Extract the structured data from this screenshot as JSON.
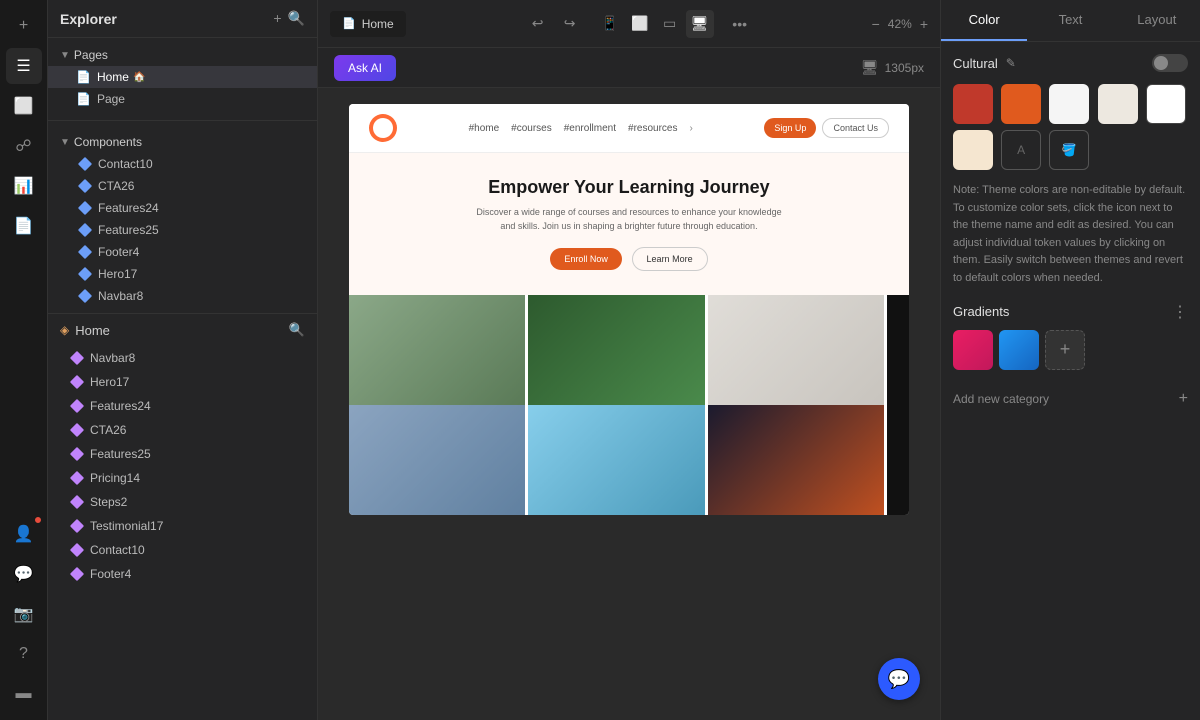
{
  "app": {
    "title": "Explorer"
  },
  "header": {
    "tab_label": "Home",
    "zoom": "42%",
    "canvas_size": "1305px"
  },
  "toolbar": {
    "ask_ai": "Ask AI",
    "undo_icon": "undo-icon",
    "redo_icon": "redo-icon",
    "device_mobile": "mobile-icon",
    "device_tablet": "tablet-icon",
    "device_desktop": "desktop-icon",
    "device_wide": "wide-icon",
    "more_icon": "more-icon",
    "zoom_out": "zoom-out-icon",
    "zoom_in": "zoom-in-icon"
  },
  "explorer": {
    "title": "Explorer",
    "pages_section": "Pages",
    "pages": [
      {
        "label": "Home",
        "active": true,
        "has_home_icon": true
      },
      {
        "label": "Page",
        "active": false,
        "has_home_icon": false
      }
    ],
    "components_section": "Components",
    "components": [
      "Contact10",
      "CTA26",
      "Features24",
      "Features25",
      "Footer4",
      "Hero17",
      "Navbar8"
    ]
  },
  "home_layer": {
    "title": "Home",
    "items": [
      "Navbar8",
      "Hero17",
      "Features24",
      "CTA26",
      "Features25",
      "Pricing14",
      "Steps2",
      "Testimonial17",
      "Contact10",
      "Footer4"
    ]
  },
  "preview": {
    "nav_links": [
      "#home",
      "#courses",
      "#enrollment",
      "#resources",
      "›"
    ],
    "signup_btn": "Sign Up",
    "contact_btn": "Contact Us",
    "hero_title": "Empower Your Learning Journey",
    "hero_desc": "Discover a wide range of courses and resources to enhance your knowledge and skills. Join us in shaping a brighter future through education.",
    "hero_btn1": "Enroll Now",
    "hero_btn2": "Learn More"
  },
  "right_panel": {
    "tabs": [
      "Color",
      "Text",
      "Layout"
    ],
    "active_tab": "Color",
    "theme_name": "Cultural",
    "note": "Note: Theme colors are non-editable by default. To customize color sets, click the icon next to the theme name and edit as desired. You can adjust individual token values by clicking on them. Easily switch between themes and revert to default colors when needed.",
    "gradients_title": "Gradients",
    "add_category_label": "Add new category",
    "swatches": [
      {
        "color": "#c0392b",
        "type": "solid"
      },
      {
        "color": "#e05a1e",
        "type": "solid"
      },
      {
        "color": "#f5f5f5",
        "type": "solid"
      },
      {
        "color": "#ede8e0",
        "type": "solid"
      },
      {
        "color": "#ffffff",
        "type": "solid"
      },
      {
        "color": "#f5e6d0",
        "type": "solid"
      },
      {
        "color": "#text",
        "type": "text"
      },
      {
        "color": "#bucket",
        "type": "bucket"
      }
    ],
    "gradients": [
      {
        "from": "#e91e63",
        "to": "#c2185b"
      },
      {
        "from": "#2196f3",
        "to": "#1565c0"
      }
    ]
  }
}
